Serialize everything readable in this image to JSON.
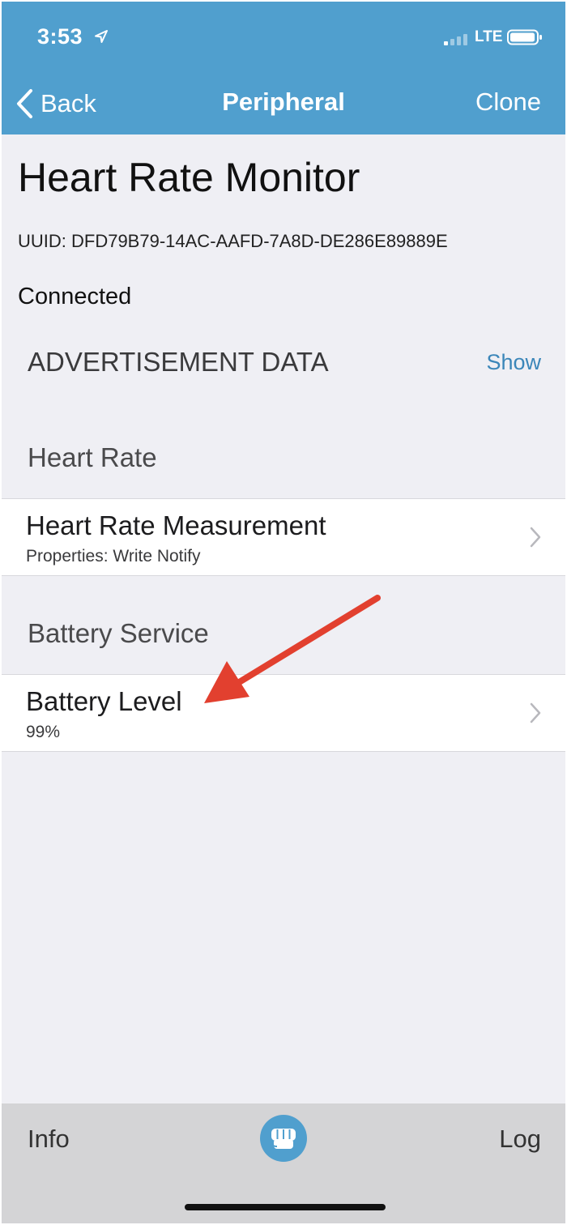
{
  "status_bar": {
    "time": "3:53",
    "network": "LTE",
    "location_icon": "location-arrow-icon",
    "signal_icon": "signal-bars-icon",
    "battery_icon": "battery-icon"
  },
  "nav": {
    "back_label": "Back",
    "title": "Peripheral",
    "right_label": "Clone"
  },
  "peripheral": {
    "name": "Heart Rate Monitor",
    "uuid": "UUID: DFD79B79-14AC-AAFD-7A8D-DE286E89889E",
    "status": "Connected"
  },
  "advertisement": {
    "title": "ADVERTISEMENT DATA",
    "action": "Show"
  },
  "services": [
    {
      "name": "Heart Rate",
      "characteristics": [
        {
          "name": "Heart Rate Measurement",
          "detail": "Properties: Write Notify"
        }
      ]
    },
    {
      "name": "Battery Service",
      "characteristics": [
        {
          "name": "Battery Level",
          "detail": "99%"
        }
      ]
    }
  ],
  "annotation": {
    "type": "red-arrow",
    "target": "Battery Level",
    "color": "#e2402f"
  },
  "tabbar": {
    "left_label": "Info",
    "right_label": "Log",
    "center_icon": "fist-icon"
  },
  "colors": {
    "header_bg": "#509fce",
    "accent": "#3b86b9",
    "background": "#efeff4",
    "tabbar_bg": "#d4d4d6"
  }
}
